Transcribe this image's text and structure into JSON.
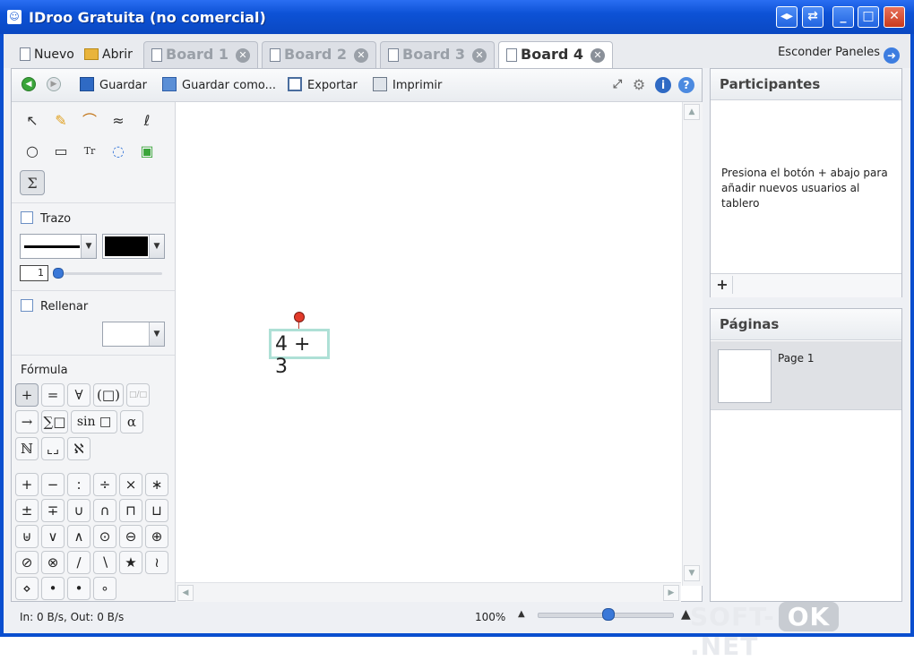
{
  "window": {
    "title": "IDroo Gratuita (no comercial)",
    "buttons": [
      "◂▸",
      "⇄",
      "_",
      "□",
      "✕"
    ]
  },
  "tabbar": {
    "new_label": "Nuevo",
    "open_label": "Abrir",
    "tabs": [
      {
        "label": "Board 1",
        "active": false
      },
      {
        "label": "Board 2",
        "active": false
      },
      {
        "label": "Board 3",
        "active": false
      },
      {
        "label": "Board 4",
        "active": true
      }
    ],
    "hide_panels_label": "Esconder Paneles"
  },
  "toolbar": {
    "save_label": "Guardar",
    "save_as_label": "Guardar como...",
    "export_label": "Exportar",
    "print_label": "Imprimir"
  },
  "tools": {
    "stroke_label": "Trazo",
    "stroke_width": "1",
    "fill_label": "Rellenar",
    "formula_label": "Fórmula",
    "text_tool_glyph": "Tr",
    "sigma_glyph": "Σ",
    "formula_row1": [
      "+",
      "=",
      "∀",
      "(□)",
      "□/□"
    ],
    "formula_row2": [
      "→",
      "∑□",
      "sin □",
      "α"
    ],
    "formula_row3": [
      "ℕ",
      "⌞⌟",
      "ℵ"
    ],
    "operators": [
      [
        "+",
        "−",
        ":",
        "÷",
        "×",
        "∗"
      ],
      [
        "±",
        "∓",
        "∪",
        "∩",
        "⊓",
        "⊔"
      ],
      [
        "⊎",
        "∨",
        "∧",
        "⊙",
        "⊖",
        "⊕"
      ],
      [
        "⊘",
        "⊗",
        "∕",
        "∖",
        "★",
        "≀"
      ],
      [
        "⋄",
        "•",
        "•",
        "∘"
      ]
    ],
    "stroke_color": "#000000",
    "fill_color": "#ffffff"
  },
  "canvas": {
    "formula": "4 + 3"
  },
  "participants": {
    "title": "Participantes",
    "hint": "Presiona el botón + abajo para añadir nuevos usuarios al tablero",
    "add_glyph": "+"
  },
  "pages": {
    "title": "Páginas",
    "items": [
      {
        "label": "Page 1"
      }
    ]
  },
  "status": {
    "traffic": "In: 0 B/s, Out: 0 B/s",
    "zoom": "100%",
    "watermark_left": "SOFT-",
    "watermark_ok": "OK",
    "watermark_right": ".NET"
  }
}
